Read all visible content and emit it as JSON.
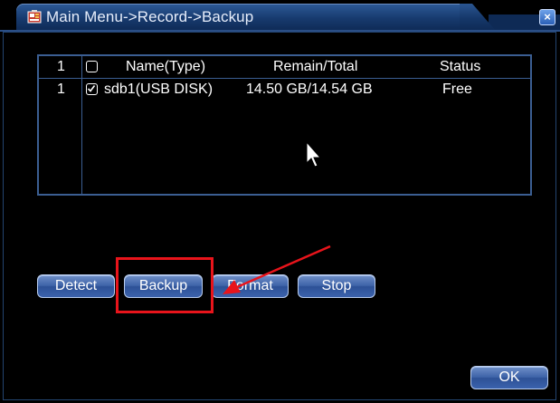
{
  "window": {
    "title": "Main Menu->Record->Backup",
    "close_glyph": "×",
    "title_icon": "record-menu-icon"
  },
  "table": {
    "header": {
      "index": "1",
      "name": "Name(Type)",
      "remain_total": "Remain/Total",
      "status": "Status"
    },
    "rows": [
      {
        "index": "1",
        "checked": true,
        "name": "sdb1(USB DISK)",
        "remain_total": "14.50 GB/14.54 GB",
        "status": "Free"
      }
    ]
  },
  "buttons": {
    "detect": "Detect",
    "backup": "Backup",
    "format": "Format",
    "stop": "Stop",
    "ok": "OK"
  },
  "annotation": {
    "highlight_color": "#e8141b",
    "highlighted": "backup-button"
  },
  "colors": {
    "background": "#000000",
    "title_bar": "#173a6e",
    "grid_line": "#3b5e92",
    "button": "#3e63a8"
  }
}
